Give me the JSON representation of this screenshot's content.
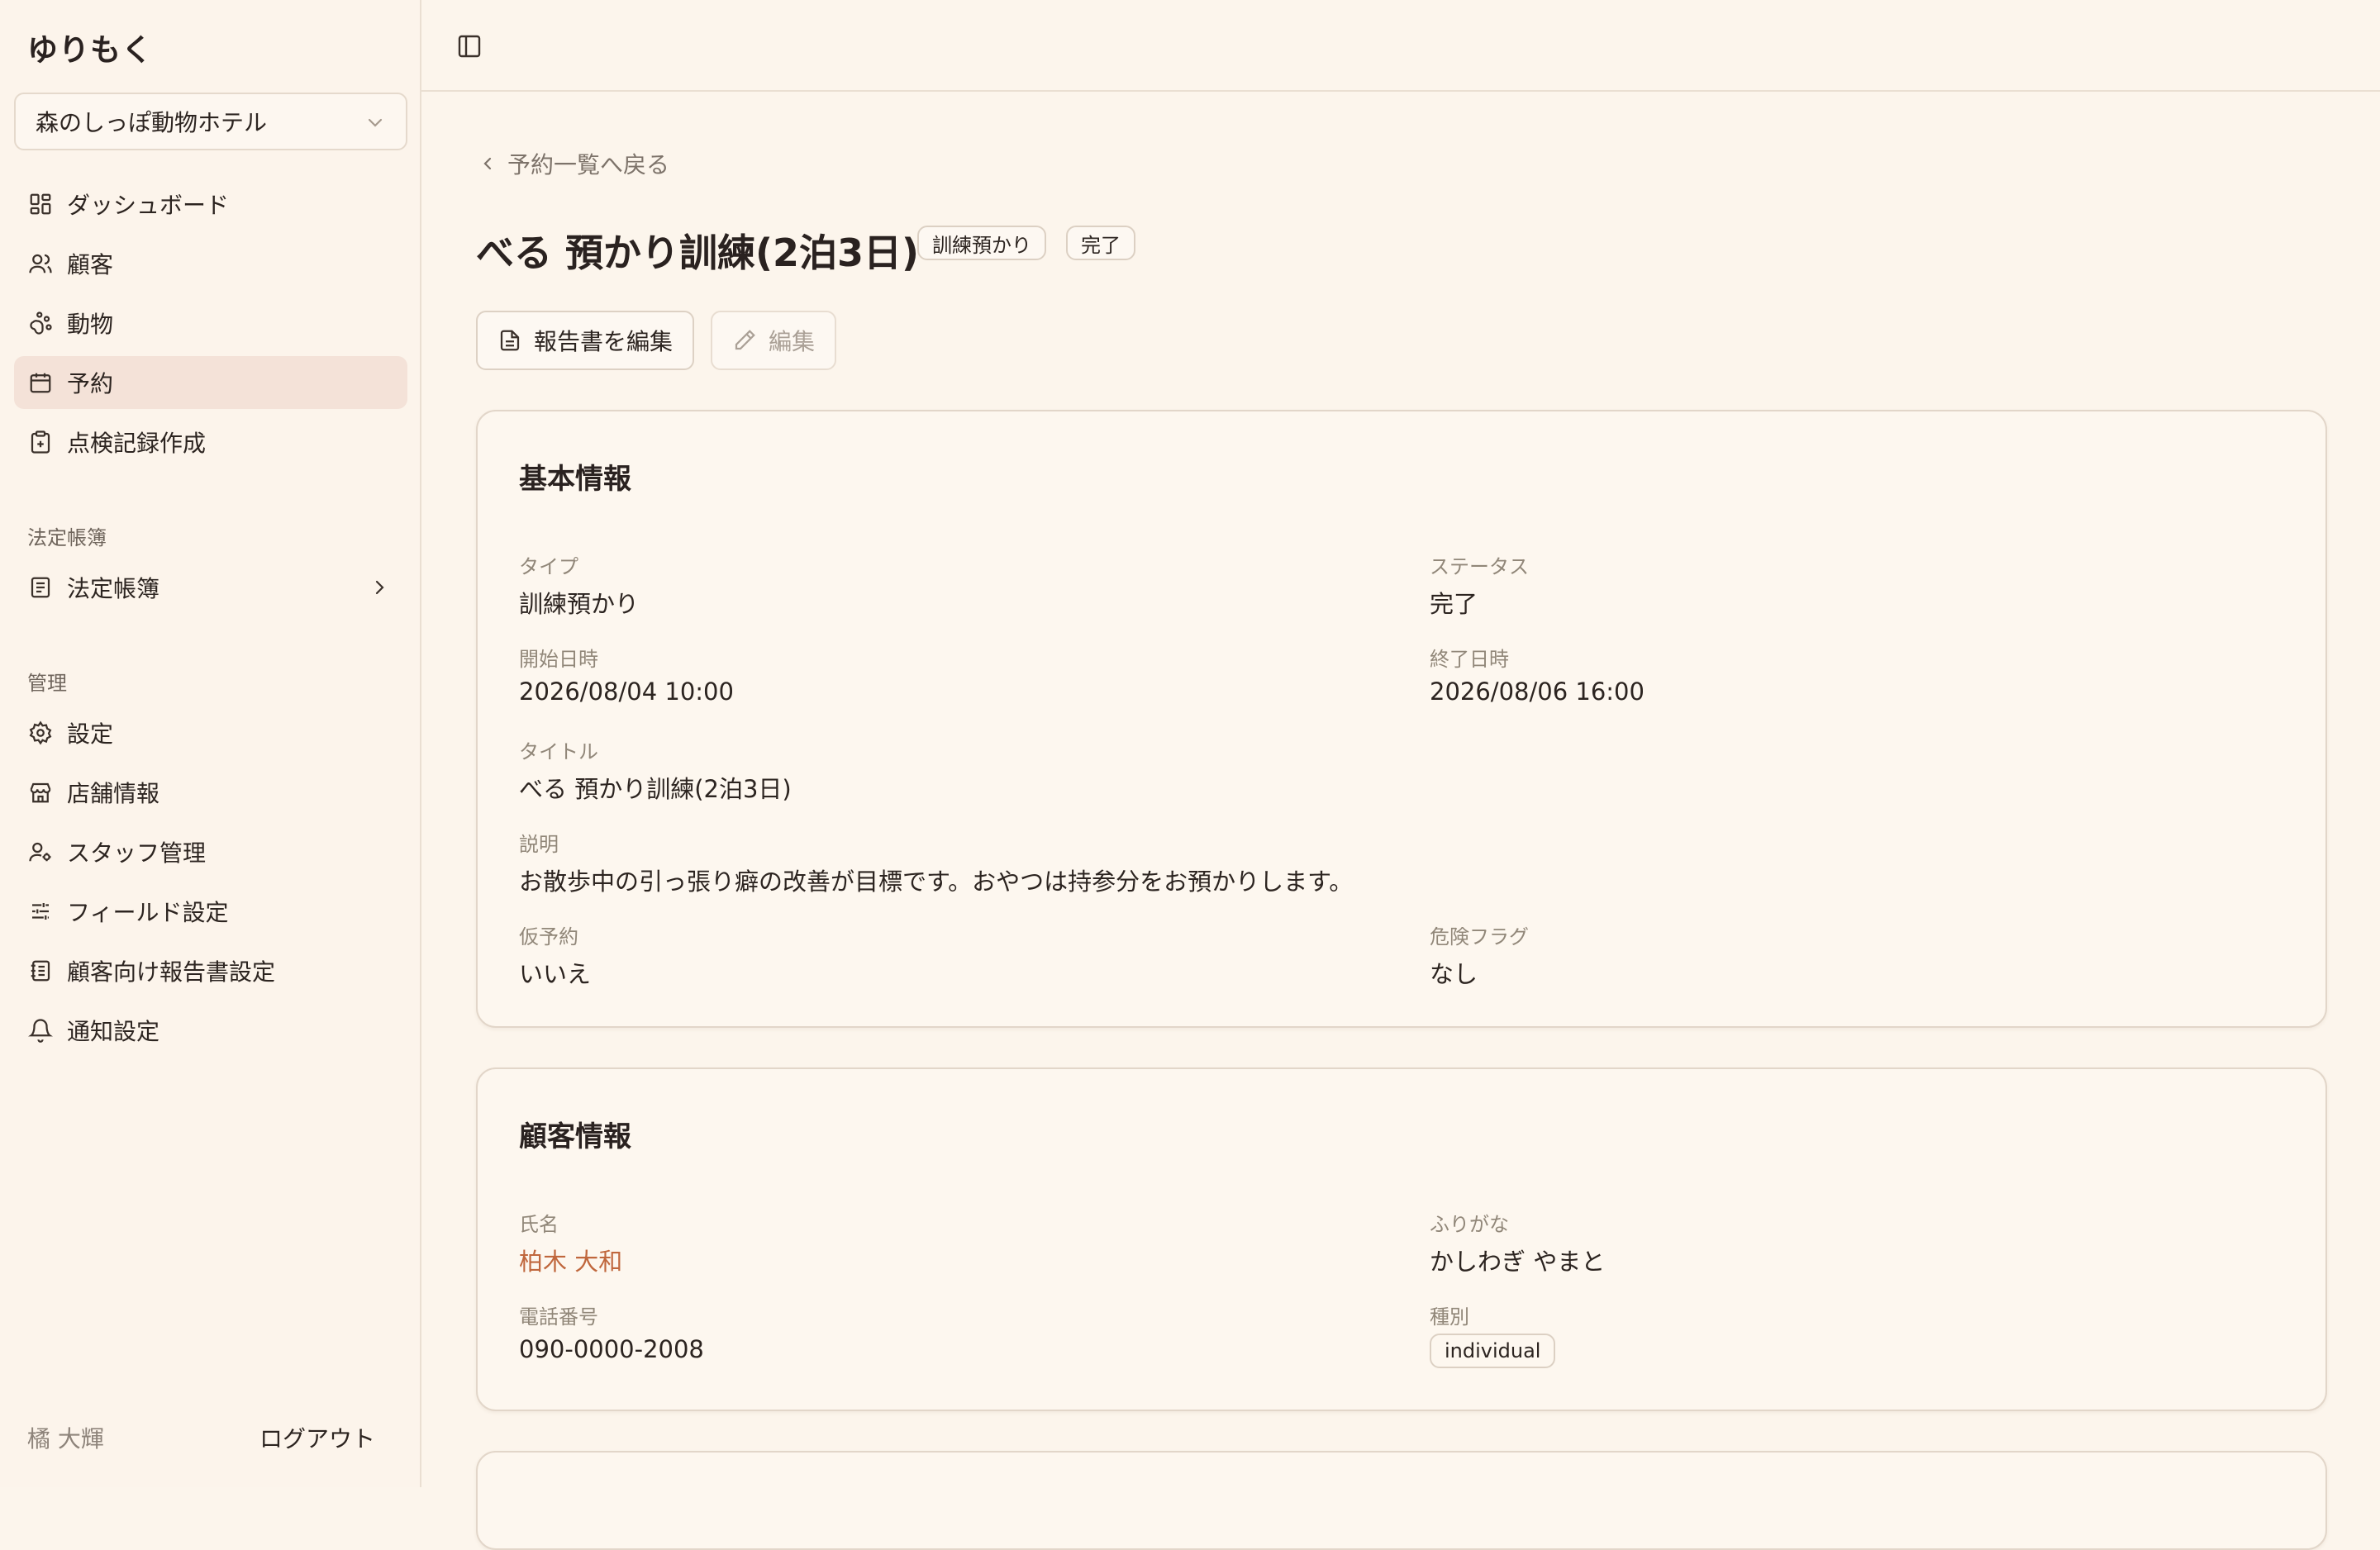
{
  "app": {
    "title": "ゆりもく"
  },
  "shop_selector": {
    "value": "森のしっぽ動物ホテル",
    "icon": "chevron-down-icon"
  },
  "nav": {
    "main": [
      {
        "label": "ダッシュボード",
        "icon": "dashboard-icon"
      },
      {
        "label": "顧客",
        "icon": "users-icon"
      },
      {
        "label": "動物",
        "icon": "paw-icon"
      },
      {
        "label": "予約",
        "icon": "calendar-icon",
        "active": true
      },
      {
        "label": "点検記録作成",
        "icon": "clipboard-plus-icon"
      }
    ],
    "ledger_section": "法定帳簿",
    "ledger_item": {
      "label": "法定帳簿",
      "icon": "book-icon"
    },
    "admin_section": "管理",
    "admin": [
      {
        "label": "設定",
        "icon": "gear-icon"
      },
      {
        "label": "店舗情報",
        "icon": "store-icon"
      },
      {
        "label": "スタッフ管理",
        "icon": "user-cog-icon"
      },
      {
        "label": "フィールド設定",
        "icon": "sliders-icon"
      },
      {
        "label": "顧客向け報告書設定",
        "icon": "report-icon"
      },
      {
        "label": "通知設定",
        "icon": "bell-icon"
      }
    ]
  },
  "footer": {
    "user": "橘 大輝",
    "logout": "ログアウト"
  },
  "page": {
    "back": "予約一覧へ戻る",
    "title": "べる 預かり訓練(2泊3日)",
    "badges": [
      "訓練預かり",
      "完了"
    ],
    "actions": {
      "edit_report": "報告書を編集",
      "edit": "編集"
    }
  },
  "basic": {
    "title": "基本情報",
    "type_label": "タイプ",
    "type_value": "訓練預かり",
    "status_label": "ステータス",
    "status_value": "完了",
    "start_label": "開始日時",
    "start_value": "2026/08/04 10:00",
    "end_label": "終了日時",
    "end_value": "2026/08/06 16:00",
    "title_label": "タイトル",
    "title_value": "べる 預かり訓練(2泊3日)",
    "desc_label": "説明",
    "desc_value": "お散歩中の引っ張り癖の改善が目標です。おやつは持参分をお預かりします。",
    "tentative_label": "仮予約",
    "tentative_value": "いいえ",
    "danger_label": "危険フラグ",
    "danger_value": "なし"
  },
  "customer": {
    "title": "顧客情報",
    "name_label": "氏名",
    "name_value": "柏木 大和",
    "kana_label": "ふりがな",
    "kana_value": "かしわぎ やまと",
    "phone_label": "電話番号",
    "phone_value": "090-0000-2008",
    "kind_label": "種別",
    "kind_value": "individual"
  },
  "colors": {
    "accent": "#c0673d",
    "background": "#fcf5ec",
    "active_nav": "#f4e2d8"
  }
}
